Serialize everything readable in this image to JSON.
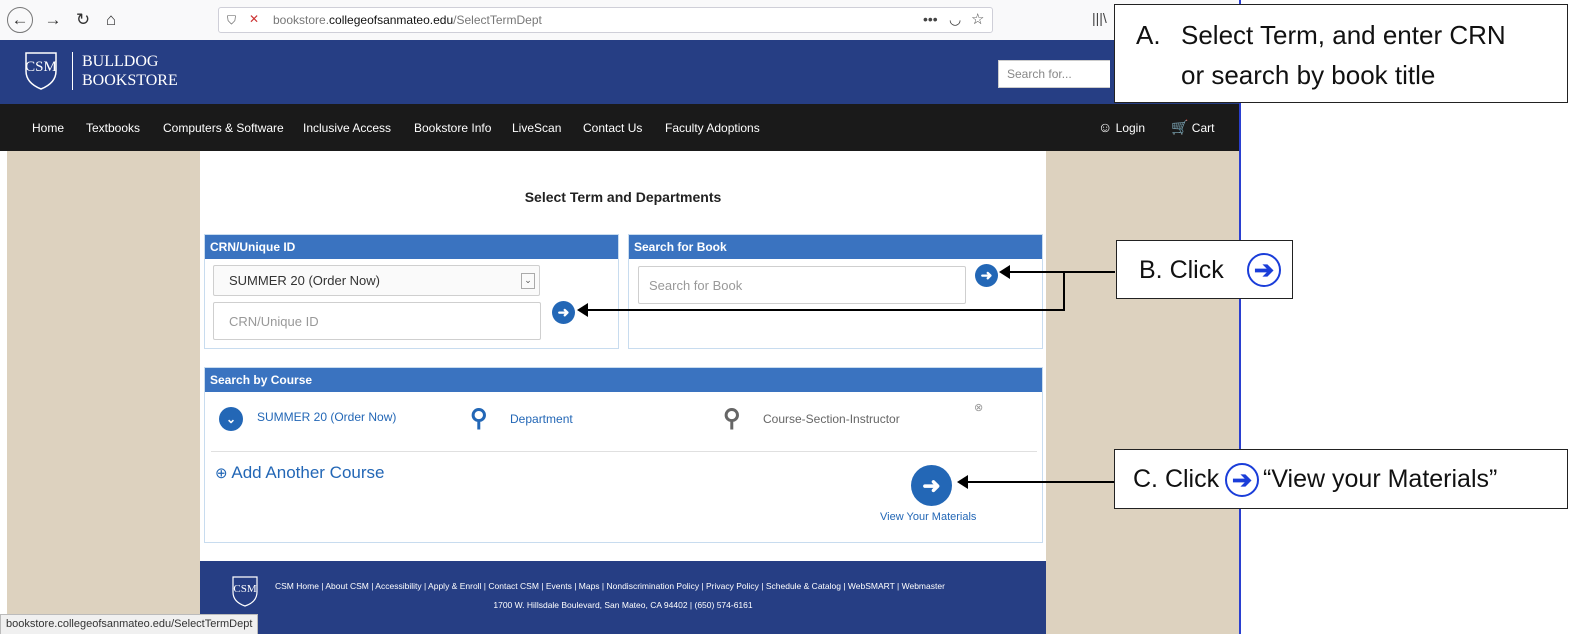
{
  "browser": {
    "url_prefix": "bookstore.",
    "url_domain": "collegeofsanmateo.edu",
    "url_path": "/SelectTermDept",
    "status_url": "bookstore.collegeofsanmateo.edu/SelectTermDept"
  },
  "header": {
    "logo_mark": "CSM",
    "logo_line1": "BULLDOG",
    "logo_line2": "BOOKSTORE",
    "search_placeholder": "Search for..."
  },
  "nav": {
    "items": [
      "Home",
      "Textbooks",
      "Computers & Software",
      "Inclusive Access",
      "Bookstore Info",
      "LiveScan",
      "Contact Us",
      "Faculty Adoptions"
    ],
    "login": "Login",
    "cart": "Cart"
  },
  "page": {
    "title": "Select Term and Departments"
  },
  "crn": {
    "header": "CRN/Unique ID",
    "term_selected": "SUMMER 20 (Order Now)",
    "crn_placeholder": "CRN/Unique ID"
  },
  "book_search": {
    "header": "Search for Book",
    "placeholder": "Search for Book"
  },
  "course": {
    "header": "Search by Course",
    "term": "SUMMER 20 (Order Now)",
    "department": "Department",
    "course_section": "Course-Section-Instructor",
    "add_another": "Add Another Course",
    "view_materials": "View Your Materials"
  },
  "footer": {
    "links": "CSM Home | About CSM | Accessibility | Apply & Enroll | Contact CSM | Events | Maps | Nondiscrimination Policy | Privacy Policy | Schedule & Catalog | WebSMART | Webmaster",
    "address": "1700 W. Hillsdale Boulevard, San Mateo, CA 94402  |  (650) 574-6161"
  },
  "callouts": {
    "a_label": "A.",
    "a_line1": "Select Term, and enter CRN",
    "a_line2": "or search by book title",
    "b_text": "B. Click",
    "c_text": "C. Click",
    "c_suffix": "“View your Materials”"
  },
  "colors": {
    "header_blue": "#263e84",
    "box_header_blue": "#3a73c0",
    "annotation_blue": "#1a3dd9",
    "content_beige": "#ddd2bf"
  }
}
